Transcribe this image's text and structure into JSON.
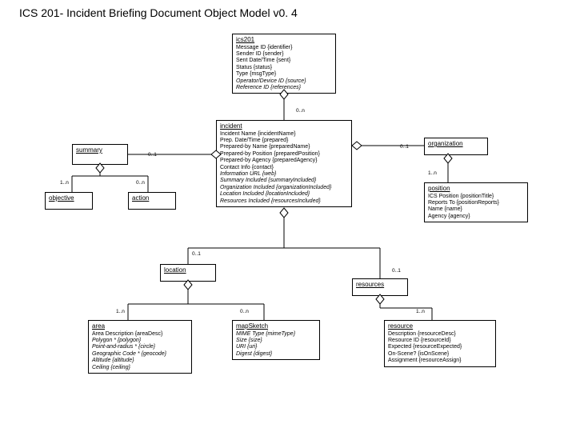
{
  "title": "ICS 201- Incident Briefing Document Object Model v0. 4",
  "ics201": {
    "name": "ics201",
    "attrs": [
      "Message ID {identifier}",
      "Sender ID {sender}",
      "Sent Date/Time {sent}",
      "Status {status}",
      "Type {msgType}",
      "Operator/Device ID {source}",
      "Reference ID {references}"
    ]
  },
  "incident": {
    "name": "incident",
    "attrs": [
      "Incident Name {incidentName}",
      "Prep. Date/Time {prepared}",
      "Prepared-by Name {preparedName}",
      "Prepared-by Position {preparedPosition}",
      "Prepared-by Agency {preparedAgency}",
      "Contact Info {contact}",
      "Information URL {web}",
      "Summary Included {summaryIncluded}",
      "Organization Included {organizationIncluded}",
      "Location Included {locationIncluded}",
      "Resources Included {resourcesIncluded}"
    ]
  },
  "summary": {
    "name": "summary"
  },
  "objective": {
    "name": "objective"
  },
  "action": {
    "name": "action"
  },
  "organization": {
    "name": "organization"
  },
  "position": {
    "name": "position",
    "attrs": [
      "ICS Position {positionTitle}",
      "Reports To {positionReports}",
      "Name {name}",
      "Agency {agency}"
    ]
  },
  "location": {
    "name": "location"
  },
  "resources": {
    "name": "resources"
  },
  "area": {
    "name": "area",
    "attrs": [
      "Area Description {areaDesc}",
      "Polygon * {polygon}",
      "Point-and-radius * {circle}",
      "Geographic Code * {geocode}",
      "Altitude {altitude}",
      "Ceiling {ceiling}"
    ]
  },
  "mapSketch": {
    "name": "mapSketch",
    "attrs": [
      "MIME Type {mimeType}",
      "Size {size}",
      "URI {uri}",
      "Digest {digest}"
    ]
  },
  "resource": {
    "name": "resource",
    "attrs": [
      "Description {resourceDesc}",
      "Resource ID {resourceId}",
      "Expected {resourceExpected}",
      "On-Scene? {isOnScene}",
      "Assignment {resourceAssign}"
    ]
  },
  "card": {
    "c0n_a": "0..n",
    "c01_a": "0..1",
    "c1n_a": "1..n",
    "c0n_b": "0..n",
    "c01_b": "0..1",
    "c01_c": "0..1",
    "c1n_b": "1..n",
    "c01_d": "0..1",
    "c01_e": "0..1",
    "c1n_c": "1..n",
    "c0n_c": "0..n",
    "c1n_d": "1..n"
  }
}
